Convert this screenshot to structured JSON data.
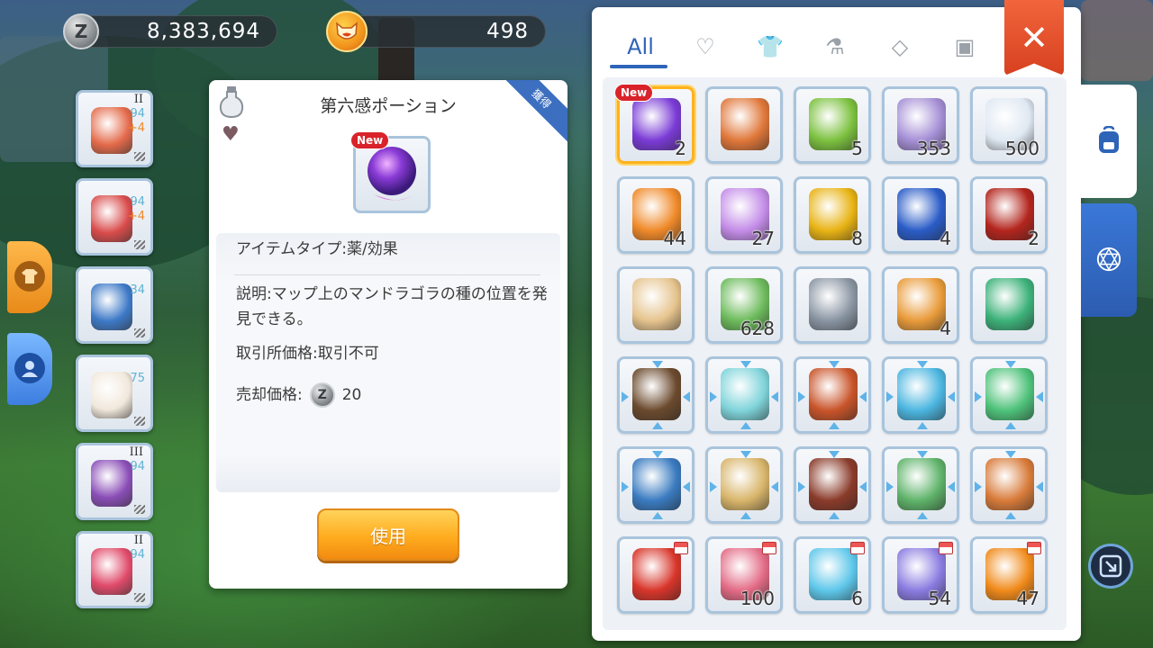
{
  "currency": {
    "zeny_symbol": "Z",
    "zeny": "8,383,694",
    "gem_icon": "cat-coin-icon",
    "gem": "498"
  },
  "equipment": [
    {
      "name": "ring",
      "tier": "II",
      "level": "94",
      "plus": "+4",
      "color": "#e46a4a"
    },
    {
      "name": "armor",
      "tier": "",
      "level": "94",
      "plus": "+4",
      "color": "#d94b4b"
    },
    {
      "name": "cape",
      "tier": "",
      "level": "34",
      "plus": "",
      "color": "#3d79c7"
    },
    {
      "name": "boots",
      "tier": "",
      "level": "75",
      "plus": "",
      "color": "#f1e8dc"
    },
    {
      "name": "accessory",
      "tier": "III",
      "level": "94",
      "plus": "",
      "color": "#8a4db7"
    },
    {
      "name": "necklace",
      "tier": "II",
      "level": "94",
      "plus": "",
      "color": "#e04a6a"
    }
  ],
  "detail": {
    "title": "第六感ポーション",
    "ribbon": "獲得",
    "new_badge": "New",
    "type": "アイテムタイプ:薬/効果",
    "description": "説明:マップ上のマンドラゴラの種の位置を発見できる。",
    "trade": "取引所価格:取引不可",
    "sell_label": "売却価格:",
    "sell_symbol": "Z",
    "sell_value": "20",
    "use_button": "使用"
  },
  "inventory": {
    "tabs": [
      {
        "label": "All",
        "icon": "all"
      },
      {
        "label": "♡",
        "icon": "heart-icon"
      },
      {
        "label": "👕",
        "icon": "equipment-icon"
      },
      {
        "label": "⚗",
        "icon": "potion-icon"
      },
      {
        "label": "◇",
        "icon": "gem-icon"
      },
      {
        "label": "▣",
        "icon": "card-icon"
      }
    ],
    "close": "✕",
    "items": [
      {
        "name": "sixth-sense-potion",
        "qty": "2",
        "color": "#7a3bd6",
        "new": "New",
        "selected": true
      },
      {
        "name": "dodo-bird",
        "qty": "",
        "color": "#e0773a"
      },
      {
        "name": "green-potion",
        "qty": "5",
        "color": "#7cc13f"
      },
      {
        "name": "wing-feather",
        "qty": "353",
        "color": "#a58fd6"
      },
      {
        "name": "white-feather",
        "qty": "500",
        "color": "#dfe8f2"
      },
      {
        "name": "orange-device",
        "qty": "44",
        "color": "#f08a2a"
      },
      {
        "name": "butterfly-wing",
        "qty": "27",
        "color": "#c48de8"
      },
      {
        "name": "yellow-card",
        "qty": "8",
        "color": "#e8b314"
      },
      {
        "name": "blue-card",
        "qty": "4",
        "color": "#2a5cc7"
      },
      {
        "name": "red-card",
        "qty": "2",
        "color": "#b3251d"
      },
      {
        "name": "scroll",
        "qty": "",
        "color": "#e6c48e"
      },
      {
        "name": "green-leaf",
        "qty": "628",
        "color": "#6dbb5c"
      },
      {
        "name": "sword-coin",
        "qty": "",
        "color": "#8a95a3"
      },
      {
        "name": "star-badge",
        "qty": "4",
        "color": "#e99b3a"
      },
      {
        "name": "green-backpack",
        "qty": "",
        "color": "#3db27a"
      },
      {
        "name": "brown-book",
        "qty": "",
        "color": "#6b4a2e",
        "arrows": true
      },
      {
        "name": "gift-box",
        "qty": "",
        "color": "#7fd4da",
        "arrows": true
      },
      {
        "name": "red-book",
        "qty": "",
        "color": "#c9542a",
        "arrows": true
      },
      {
        "name": "orb-staff",
        "qty": "",
        "color": "#4cb6e0",
        "arrows": true
      },
      {
        "name": "panda-card",
        "qty": "",
        "color": "#4ec27a",
        "arrows": true
      },
      {
        "name": "open-book",
        "qty": "",
        "color": "#3a7bc0",
        "arrows": true
      },
      {
        "name": "tower-relic",
        "qty": "",
        "color": "#d8b56a",
        "arrows": true
      },
      {
        "name": "leather-book",
        "qty": "",
        "color": "#8a3b2a",
        "arrows": true
      },
      {
        "name": "mystery-box",
        "qty": "",
        "color": "#5fb36a",
        "arrows": true
      },
      {
        "name": "travel-bag",
        "qty": "",
        "color": "#d87b3a",
        "arrows": true
      },
      {
        "name": "red-ticket",
        "qty": "",
        "color": "#d8352a",
        "shop": true
      },
      {
        "name": "pink-shell",
        "qty": "100",
        "color": "#e36b86",
        "shop": true
      },
      {
        "name": "snow-crystal",
        "qty": "6",
        "color": "#5ec7ea",
        "shop": true
      },
      {
        "name": "crystal-sword",
        "qty": "54",
        "color": "#8a7be0",
        "shop": true
      },
      {
        "name": "maple-coin",
        "qty": "47",
        "color": "#f08a1a",
        "shop": true
      }
    ]
  }
}
